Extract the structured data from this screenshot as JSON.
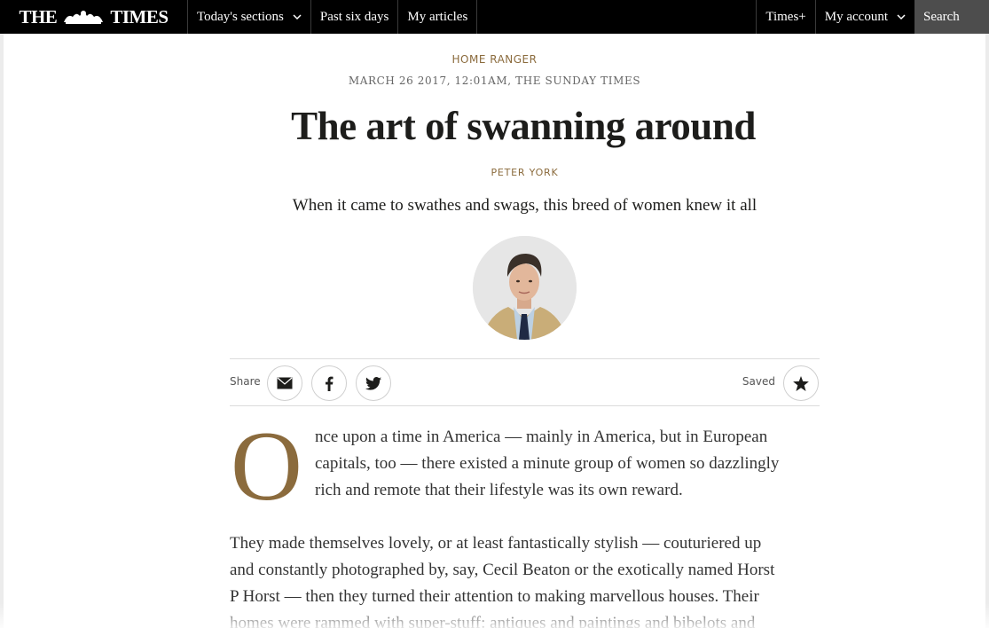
{
  "nav": {
    "logo_left": "THE",
    "logo_right": "TIMES",
    "items": [
      {
        "label": "Today's sections"
      },
      {
        "label": "Past six days"
      },
      {
        "label": "My articles"
      }
    ],
    "right_items": [
      {
        "label": "Times+"
      },
      {
        "label": "My account"
      }
    ],
    "search_label": "Search"
  },
  "article": {
    "section": "HOME RANGER",
    "dateline": "MARCH 26 2017, 12:01AM, THE SUNDAY TIMES",
    "headline": "The art of swanning around",
    "author": "PETER YORK",
    "standfirst": "When it came to swathes and swags, this breed of women knew it all",
    "dropcap": "O",
    "para1_lines": [
      "nce upon a time in America — mainly in America, but in European",
      "capitals, too — there existed a minute group of women so dazzlingly",
      "rich and remote that their lifestyle was its own reward."
    ],
    "para2_lines": [
      "They made themselves lovely, or at least fantastically stylish — couturiered up",
      "and constantly photographed by, say, Cecil Beaton or the exotically named Horst",
      "P Horst — then they turned their attention to making marvellous houses. Their",
      "homes were rammed with super-stuff: antiques and paintings and bibelots and"
    ]
  },
  "share": {
    "label": "Share",
    "saved_label": "Saved",
    "buttons": [
      "email-icon",
      "facebook-icon",
      "twitter-icon"
    ],
    "save_icon": "star-icon"
  },
  "colors": {
    "accent": "#8b6b3d",
    "nav_bg": "#000000",
    "search_bg": "#4d4d4d"
  }
}
